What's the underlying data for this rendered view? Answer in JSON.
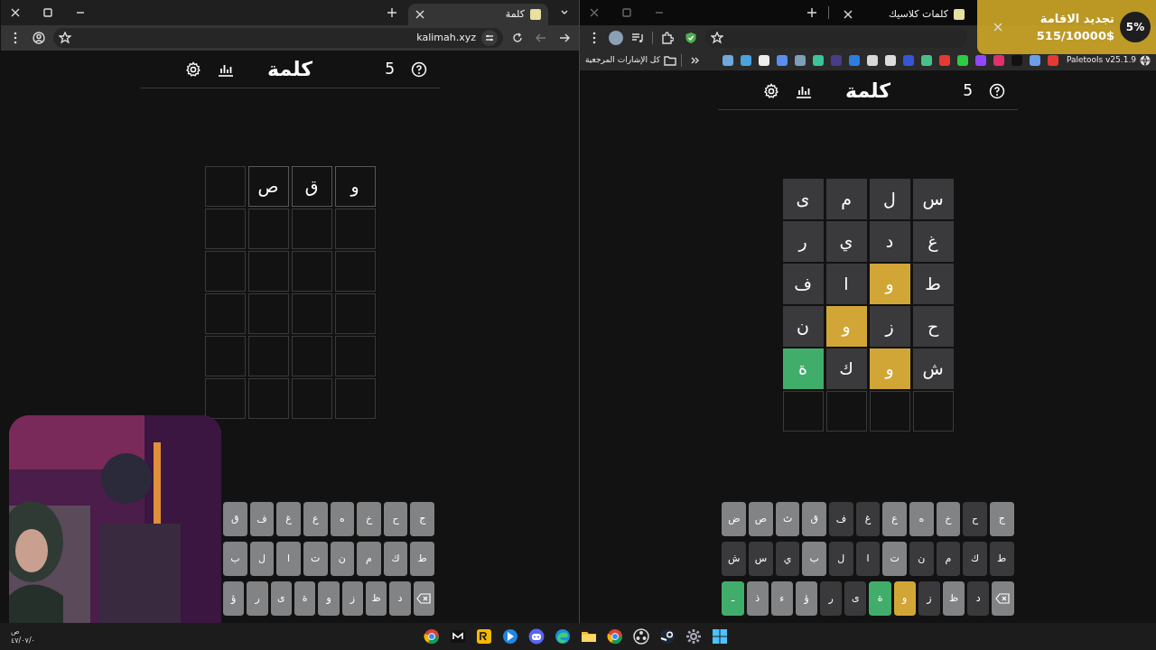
{
  "windows": [
    {
      "focused": false,
      "tabs": [
        {
          "title": "كلمات كلاسيك",
          "selected": false
        }
      ],
      "bookmarks": [
        {
          "kind": "site",
          "label": "Paletools v25.1.9"
        },
        {
          "kind": "folder",
          "label": "كل الإشارات المرجعية"
        }
      ],
      "game": {
        "title": "كلمة",
        "count": "5",
        "grid": [
          [
            {
              "kind": "scored",
              "letter": "س",
              "color": "#3a3a3c"
            },
            {
              "kind": "scored",
              "letter": "ل",
              "color": "#3a3a3c"
            },
            {
              "kind": "scored",
              "letter": "م",
              "color": "#3a3a3c"
            },
            {
              "kind": "scored",
              "letter": "ى",
              "color": "#3a3a3c"
            }
          ],
          [
            {
              "kind": "scored",
              "letter": "غ",
              "color": "#3a3a3c"
            },
            {
              "kind": "scored",
              "letter": "د",
              "color": "#3a3a3c"
            },
            {
              "kind": "scored",
              "letter": "ي",
              "color": "#3a3a3c"
            },
            {
              "kind": "scored",
              "letter": "ر",
              "color": "#3a3a3c"
            }
          ],
          [
            {
              "kind": "scored",
              "letter": "ط",
              "color": "#3a3a3c"
            },
            {
              "kind": "scored",
              "letter": "و",
              "color": "#d2a636"
            },
            {
              "kind": "scored",
              "letter": "ا",
              "color": "#3a3a3c"
            },
            {
              "kind": "scored",
              "letter": "ف",
              "color": "#3a3a3c"
            }
          ],
          [
            {
              "kind": "scored",
              "letter": "ح",
              "color": "#3a3a3c"
            },
            {
              "kind": "scored",
              "letter": "ز",
              "color": "#3a3a3c"
            },
            {
              "kind": "scored",
              "letter": "و",
              "color": "#d2a636"
            },
            {
              "kind": "scored",
              "letter": "ن",
              "color": "#3a3a3c"
            }
          ],
          [
            {
              "kind": "scored",
              "letter": "ش",
              "color": "#3a3a3c"
            },
            {
              "kind": "scored",
              "letter": "و",
              "color": "#d2a636"
            },
            {
              "kind": "scored",
              "letter": "ك",
              "color": "#3a3a3c"
            },
            {
              "kind": "scored",
              "letter": "ة",
              "color": "#41ad6b"
            }
          ],
          [
            {
              "kind": "empty"
            },
            {
              "kind": "empty"
            },
            {
              "kind": "empty"
            },
            {
              "kind": "empty"
            }
          ]
        ],
        "keyboard": [
          [
            {
              "kind": "letter",
              "label": "ج",
              "color": "#818384"
            },
            {
              "kind": "letter",
              "label": "ح",
              "color": "#3a3a3c"
            },
            {
              "kind": "letter",
              "label": "خ",
              "color": "#818384"
            },
            {
              "kind": "letter",
              "label": "ه",
              "color": "#818384"
            },
            {
              "kind": "letter",
              "label": "ع",
              "color": "#818384"
            },
            {
              "kind": "letter",
              "label": "غ",
              "color": "#3a3a3c"
            },
            {
              "kind": "letter",
              "label": "ف",
              "color": "#3a3a3c"
            },
            {
              "kind": "letter",
              "label": "ق",
              "color": "#818384"
            },
            {
              "kind": "letter",
              "label": "ث",
              "color": "#818384"
            },
            {
              "kind": "letter",
              "label": "ص",
              "color": "#818384"
            },
            {
              "kind": "letter",
              "label": "ض",
              "color": "#818384"
            }
          ],
          [
            {
              "kind": "letter",
              "label": "ط",
              "color": "#3a3a3c"
            },
            {
              "kind": "letter",
              "label": "ك",
              "color": "#3a3a3c"
            },
            {
              "kind": "letter",
              "label": "م",
              "color": "#3a3a3c"
            },
            {
              "kind": "letter",
              "label": "ن",
              "color": "#3a3a3c"
            },
            {
              "kind": "letter",
              "label": "ت",
              "color": "#818384"
            },
            {
              "kind": "letter",
              "label": "ا",
              "color": "#3a3a3c"
            },
            {
              "kind": "letter",
              "label": "ل",
              "color": "#3a3a3c"
            },
            {
              "kind": "letter",
              "label": "ب",
              "color": "#818384"
            },
            {
              "kind": "letter",
              "label": "ي",
              "color": "#3a3a3c"
            },
            {
              "kind": "letter",
              "label": "س",
              "color": "#3a3a3c"
            },
            {
              "kind": "letter",
              "label": "ش",
              "color": "#3a3a3c"
            }
          ],
          [
            {
              "kind": "backspace",
              "color": "#818384"
            },
            {
              "kind": "letter",
              "label": "د",
              "color": "#3a3a3c"
            },
            {
              "kind": "letter",
              "label": "ظ",
              "color": "#818384"
            },
            {
              "kind": "letter",
              "label": "ز",
              "color": "#3a3a3c"
            },
            {
              "kind": "letter",
              "label": "و",
              "color": "#d2a636"
            },
            {
              "kind": "letter",
              "label": "ة",
              "color": "#41ad6b"
            },
            {
              "kind": "letter",
              "label": "ى",
              "color": "#3a3a3c"
            },
            {
              "kind": "letter",
              "label": "ر",
              "color": "#3a3a3c"
            },
            {
              "kind": "letter",
              "label": "ؤ",
              "color": "#818384"
            },
            {
              "kind": "letter",
              "label": "ء",
              "color": "#818384"
            },
            {
              "kind": "letter",
              "label": "ذ",
              "color": "#818384"
            },
            {
              "kind": "enter",
              "label": "ـ",
              "color": "#41ad6b"
            }
          ]
        ]
      }
    },
    {
      "focused": true,
      "tabs": [
        {
          "title": "كلمة",
          "selected": true
        }
      ],
      "address": "kalimah.xyz",
      "game": {
        "title": "كلمة",
        "count": "5",
        "grid": [
          [
            {
              "kind": "typed",
              "letter": "و"
            },
            {
              "kind": "typed",
              "letter": "ق"
            },
            {
              "kind": "typed",
              "letter": "ص"
            },
            {
              "kind": "empty"
            }
          ],
          [
            {
              "kind": "empty"
            },
            {
              "kind": "empty"
            },
            {
              "kind": "empty"
            },
            {
              "kind": "empty"
            }
          ],
          [
            {
              "kind": "empty"
            },
            {
              "kind": "empty"
            },
            {
              "kind": "empty"
            },
            {
              "kind": "empty"
            }
          ],
          [
            {
              "kind": "empty"
            },
            {
              "kind": "empty"
            },
            {
              "kind": "empty"
            },
            {
              "kind": "empty"
            }
          ],
          [
            {
              "kind": "empty"
            },
            {
              "kind": "empty"
            },
            {
              "kind": "empty"
            },
            {
              "kind": "empty"
            }
          ],
          [
            {
              "kind": "empty"
            },
            {
              "kind": "empty"
            },
            {
              "kind": "empty"
            },
            {
              "kind": "empty"
            }
          ]
        ],
        "keyboard": [
          [
            {
              "kind": "letter",
              "label": "ج",
              "color": "#818384"
            },
            {
              "kind": "letter",
              "label": "ح",
              "color": "#818384"
            },
            {
              "kind": "letter",
              "label": "خ",
              "color": "#818384"
            },
            {
              "kind": "letter",
              "label": "ه",
              "color": "#818384"
            },
            {
              "kind": "letter",
              "label": "ع",
              "color": "#818384"
            },
            {
              "kind": "letter",
              "label": "غ",
              "color": "#818384"
            },
            {
              "kind": "letter",
              "label": "ف",
              "color": "#818384"
            },
            {
              "kind": "letter",
              "label": "ق",
              "color": "#818384"
            }
          ],
          [
            {
              "kind": "letter",
              "label": "ط",
              "color": "#818384"
            },
            {
              "kind": "letter",
              "label": "ك",
              "color": "#818384"
            },
            {
              "kind": "letter",
              "label": "م",
              "color": "#818384"
            },
            {
              "kind": "letter",
              "label": "ن",
              "color": "#818384"
            },
            {
              "kind": "letter",
              "label": "ت",
              "color": "#818384"
            },
            {
              "kind": "letter",
              "label": "ا",
              "color": "#818384"
            },
            {
              "kind": "letter",
              "label": "ل",
              "color": "#818384"
            },
            {
              "kind": "letter",
              "label": "ب",
              "color": "#818384"
            }
          ],
          [
            {
              "kind": "backspace",
              "color": "#818384"
            },
            {
              "kind": "letter",
              "label": "د",
              "color": "#818384"
            },
            {
              "kind": "letter",
              "label": "ظ",
              "color": "#818384"
            },
            {
              "kind": "letter",
              "label": "ز",
              "color": "#818384"
            },
            {
              "kind": "letter",
              "label": "و",
              "color": "#818384"
            },
            {
              "kind": "letter",
              "label": "ة",
              "color": "#818384"
            },
            {
              "kind": "letter",
              "label": "ى",
              "color": "#818384"
            },
            {
              "kind": "letter",
              "label": "ر",
              "color": "#818384"
            },
            {
              "kind": "letter",
              "label": "ؤ",
              "color": "#818384"
            }
          ]
        ]
      }
    }
  ],
  "notification": {
    "title": "تجديد الاقامة",
    "amount": "515/10000$",
    "percent": "5%"
  },
  "clock": {
    "period": "ص",
    "date": "٤٧/٠٧/٠"
  }
}
